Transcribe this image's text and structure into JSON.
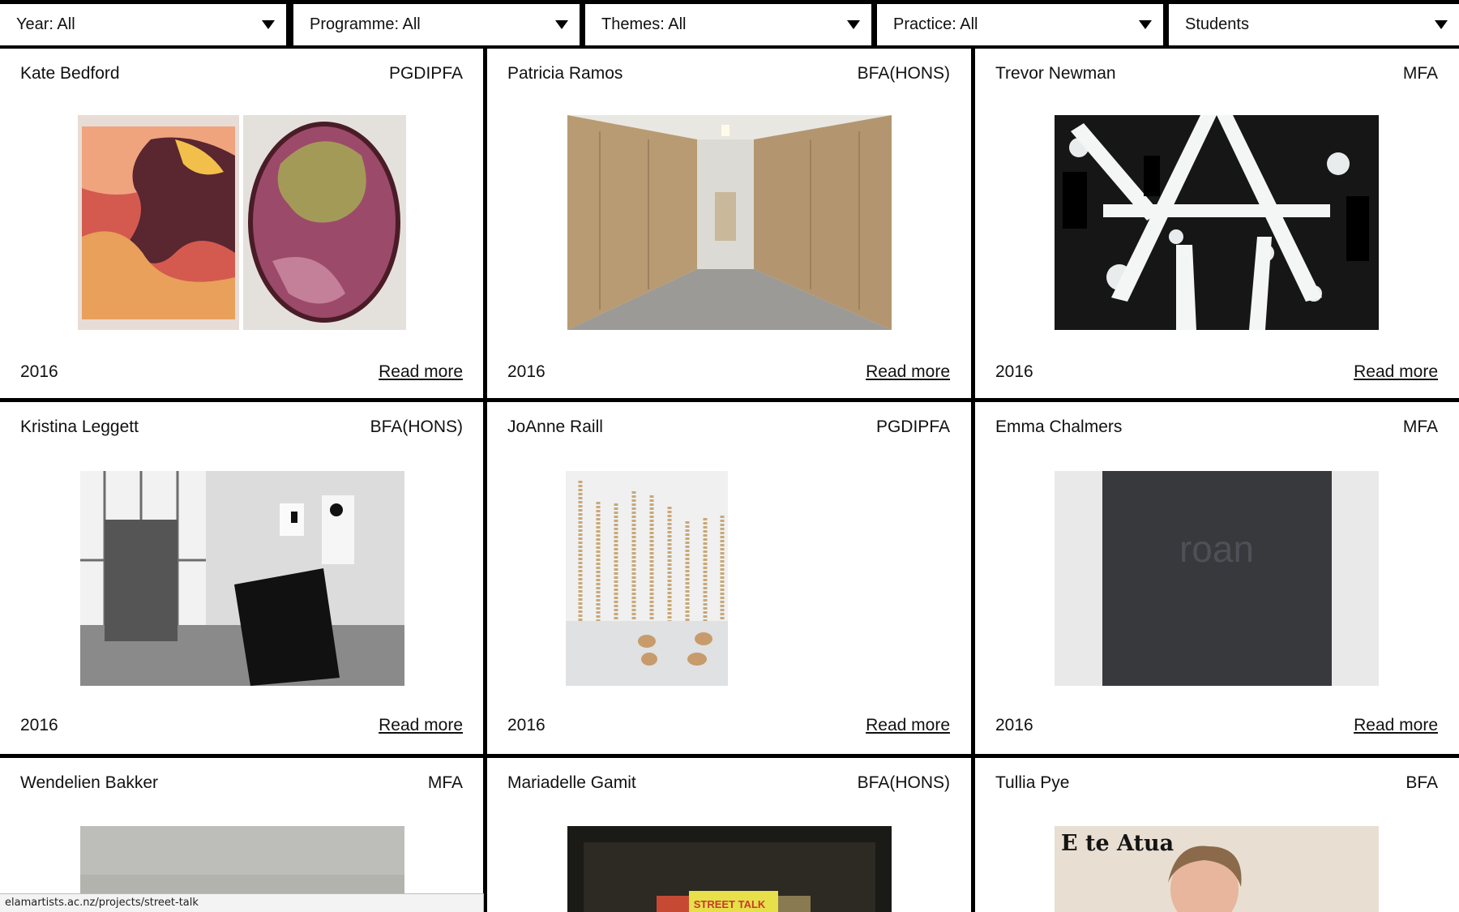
{
  "filters": [
    {
      "label": "Year: All"
    },
    {
      "label": "Programme: All"
    },
    {
      "label": "Themes: All"
    },
    {
      "label": "Practice: All"
    },
    {
      "label": "Students"
    }
  ],
  "cards": [
    {
      "name": "Kate Bedford",
      "programme": "PGDIPFA",
      "year": "2016",
      "link": "Read more"
    },
    {
      "name": "Patricia Ramos",
      "programme": "BFA(HONS)",
      "year": "2016",
      "link": "Read more"
    },
    {
      "name": "Trevor Newman",
      "programme": "MFA",
      "year": "2016",
      "link": "Read more"
    },
    {
      "name": "Kristina Leggett",
      "programme": "BFA(HONS)",
      "year": "2016",
      "link": "Read more"
    },
    {
      "name": "JoAnne Raill",
      "programme": "PGDIPFA",
      "year": "2016",
      "link": "Read more"
    },
    {
      "name": "Emma Chalmers",
      "programme": "MFA",
      "year": "2016",
      "link": "Read more"
    },
    {
      "name": "Wendelien Bakker",
      "programme": "MFA"
    },
    {
      "name": "Mariadelle Gamit",
      "programme": "BFA(HONS)"
    },
    {
      "name": "Tullia Pye",
      "programme": "BFA"
    }
  ],
  "artwork_text": {
    "emma_chalmers": "roan",
    "tullia_pye": "E te Atua",
    "mariadelle_gamit": "STREET TALK"
  },
  "status_bar": {
    "url": "elamartists.ac.nz/projects/street-talk"
  }
}
